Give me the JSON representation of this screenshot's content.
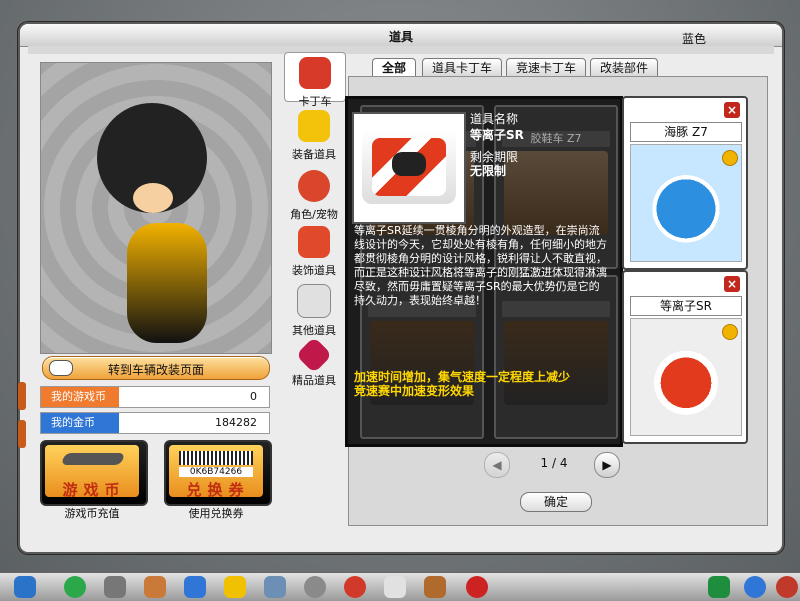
{
  "window": {
    "title": "道具",
    "color_tag": "蓝色"
  },
  "left": {
    "goto_mod_label": "转到车辆改装页面",
    "balances": [
      {
        "label": "我的游戏币",
        "value": "0",
        "color": "#f07a2d"
      },
      {
        "label": "我的金币",
        "value": "184282",
        "color": "#2f76d6"
      }
    ],
    "buttons": [
      {
        "big": "游戏币",
        "caption": "游戏币充值"
      },
      {
        "big": "兑换券",
        "caption": "使用兑换券",
        "code": "0K6B74266"
      }
    ]
  },
  "categories": [
    {
      "label": "卡丁车",
      "icon": "kart-icon",
      "color": "#d83a2a"
    },
    {
      "label": "装备道具",
      "icon": "goggles-icon",
      "color": "#f3c20a"
    },
    {
      "label": "角色/宠物",
      "icon": "character-icon",
      "color": "#d9462b"
    },
    {
      "label": "装饰道具",
      "icon": "fire-shirt-icon",
      "color": "#e04a2a"
    },
    {
      "label": "其他道具",
      "icon": "gift-bag-icon",
      "color": "#e0e0e0"
    },
    {
      "label": "精品道具",
      "icon": "ruby-icon",
      "color": "#c1184a"
    }
  ],
  "tabs": [
    "全部",
    "道具卡丁车",
    "竞速卡丁车",
    "改装部件"
  ],
  "grid": {
    "cells": [
      {
        "name": ""
      },
      {
        "name": "胶鞋车 Z7"
      },
      {
        "name": ""
      },
      {
        "name": ""
      }
    ]
  },
  "tooltip": {
    "name_key": "道具名称",
    "name_val": "等离子SR",
    "expire_key": "剩余期限",
    "expire_val": "无限制",
    "description": "等离子SR延续一贯棱角分明的外观造型，在崇尚流线设计的今天，它却处处有棱有角，任何细小的地方都贯彻棱角分明的设计风格，锐利得让人不敢直视，而正是这种设计风格将等离子的刚猛激进体现得淋漓尽致，然而毋庸置疑等离子SR的最大优势仍是它的持久动力，表现始终卓越！",
    "effect": "加速时间增加，集气速度一定程度上减少\n竞速赛中加速变形效果"
  },
  "right_cards": [
    {
      "name": "海豚 Z7"
    },
    {
      "name": "等离子SR"
    }
  ],
  "pager": {
    "current": "1",
    "total": "4",
    "sep": "/"
  },
  "ok_label": "确定"
}
